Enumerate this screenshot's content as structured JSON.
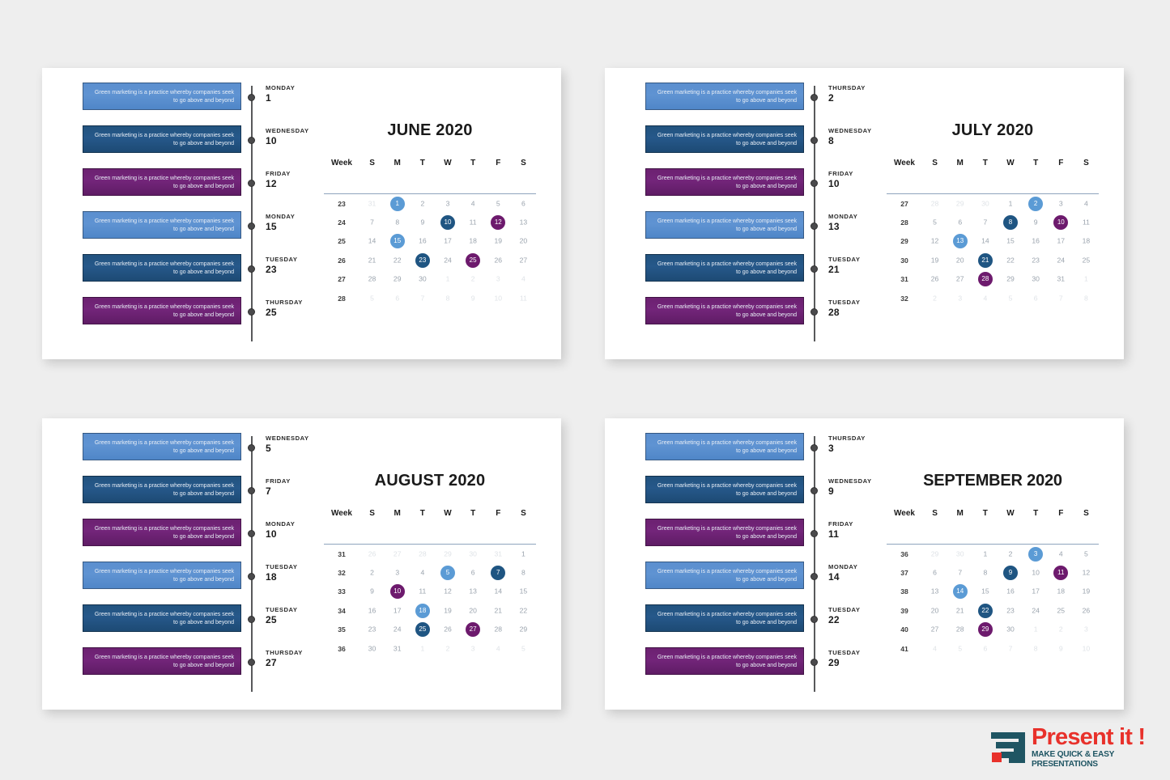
{
  "background_color": "#eeeeee",
  "colors": {
    "bar_light_blue": "#5b8fcf",
    "bar_dark_blue": "#22537f",
    "bar_purple": "#6c2171",
    "marker_light_blue": "#5b9bd5",
    "marker_dark_blue": "#1f5582",
    "marker_purple": "#6d1a6d",
    "timeline_axis": "#58595b",
    "header_rule": "#8fa4bd",
    "logo_red": "#e8312b",
    "logo_teal": "#1f5563"
  },
  "bar_text": "Green marketing is a practice whereby companies seek to go above and beyond",
  "week_header_label": "Week",
  "weekday_headers": [
    "S",
    "M",
    "T",
    "W",
    "T",
    "F",
    "S"
  ],
  "slides": [
    {
      "id": "june",
      "title": "JUNE 2020",
      "timeline": [
        {
          "day": "MONDAY",
          "date": "1",
          "color": "lightblue"
        },
        {
          "day": "WEDNESDAY",
          "date": "10",
          "color": "darkblue"
        },
        {
          "day": "FRIDAY",
          "date": "12",
          "color": "purple"
        },
        {
          "day": "MONDAY",
          "date": "15",
          "color": "lightblue"
        },
        {
          "day": "TUESDAY",
          "date": "23",
          "color": "darkblue"
        },
        {
          "day": "THURSDAY",
          "date": "25",
          "color": "purple"
        }
      ],
      "weeks": [
        "23",
        "24",
        "25",
        "26",
        "27",
        "28"
      ],
      "grid": [
        [
          {
            "n": "31",
            "state": "muted"
          },
          {
            "n": "1",
            "state": "marked",
            "color": "lightblue"
          },
          {
            "n": "2",
            "state": "normal"
          },
          {
            "n": "3",
            "state": "normal"
          },
          {
            "n": "4",
            "state": "normal"
          },
          {
            "n": "5",
            "state": "normal"
          },
          {
            "n": "6",
            "state": "normal"
          }
        ],
        [
          {
            "n": "7",
            "state": "normal"
          },
          {
            "n": "8",
            "state": "normal"
          },
          {
            "n": "9",
            "state": "normal"
          },
          {
            "n": "10",
            "state": "marked",
            "color": "darkblue"
          },
          {
            "n": "11",
            "state": "normal"
          },
          {
            "n": "12",
            "state": "marked",
            "color": "purple"
          },
          {
            "n": "13",
            "state": "normal"
          }
        ],
        [
          {
            "n": "14",
            "state": "normal"
          },
          {
            "n": "15",
            "state": "marked",
            "color": "lightblue"
          },
          {
            "n": "16",
            "state": "normal"
          },
          {
            "n": "17",
            "state": "normal"
          },
          {
            "n": "18",
            "state": "normal"
          },
          {
            "n": "19",
            "state": "normal"
          },
          {
            "n": "20",
            "state": "normal"
          }
        ],
        [
          {
            "n": "21",
            "state": "normal"
          },
          {
            "n": "22",
            "state": "normal"
          },
          {
            "n": "23",
            "state": "marked",
            "color": "darkblue"
          },
          {
            "n": "24",
            "state": "normal"
          },
          {
            "n": "25",
            "state": "marked",
            "color": "purple"
          },
          {
            "n": "26",
            "state": "normal"
          },
          {
            "n": "27",
            "state": "normal"
          }
        ],
        [
          {
            "n": "28",
            "state": "normal"
          },
          {
            "n": "29",
            "state": "normal"
          },
          {
            "n": "30",
            "state": "normal"
          },
          {
            "n": "1",
            "state": "muted"
          },
          {
            "n": "2",
            "state": "muted"
          },
          {
            "n": "3",
            "state": "muted"
          },
          {
            "n": "4",
            "state": "muted"
          }
        ],
        [
          {
            "n": "5",
            "state": "muted"
          },
          {
            "n": "6",
            "state": "muted"
          },
          {
            "n": "7",
            "state": "muted"
          },
          {
            "n": "8",
            "state": "muted"
          },
          {
            "n": "9",
            "state": "muted"
          },
          {
            "n": "10",
            "state": "muted"
          },
          {
            "n": "11",
            "state": "muted"
          }
        ]
      ]
    },
    {
      "id": "july",
      "title": "JULY 2020",
      "timeline": [
        {
          "day": "THURSDAY",
          "date": "2",
          "color": "lightblue"
        },
        {
          "day": "WEDNESDAY",
          "date": "8",
          "color": "darkblue"
        },
        {
          "day": "FRIDAY",
          "date": "10",
          "color": "purple"
        },
        {
          "day": "MONDAY",
          "date": "13",
          "color": "lightblue"
        },
        {
          "day": "TUESDAY",
          "date": "21",
          "color": "darkblue"
        },
        {
          "day": "TUESDAY",
          "date": "28",
          "color": "purple"
        }
      ],
      "weeks": [
        "27",
        "28",
        "29",
        "30",
        "31",
        "32"
      ],
      "grid": [
        [
          {
            "n": "28",
            "state": "muted"
          },
          {
            "n": "29",
            "state": "muted"
          },
          {
            "n": "30",
            "state": "muted"
          },
          {
            "n": "1",
            "state": "normal"
          },
          {
            "n": "2",
            "state": "marked",
            "color": "lightblue"
          },
          {
            "n": "3",
            "state": "normal"
          },
          {
            "n": "4",
            "state": "normal"
          }
        ],
        [
          {
            "n": "5",
            "state": "normal"
          },
          {
            "n": "6",
            "state": "normal"
          },
          {
            "n": "7",
            "state": "normal"
          },
          {
            "n": "8",
            "state": "marked",
            "color": "darkblue"
          },
          {
            "n": "9",
            "state": "normal"
          },
          {
            "n": "10",
            "state": "marked",
            "color": "purple"
          },
          {
            "n": "11",
            "state": "normal"
          }
        ],
        [
          {
            "n": "12",
            "state": "normal"
          },
          {
            "n": "13",
            "state": "marked",
            "color": "lightblue"
          },
          {
            "n": "14",
            "state": "normal"
          },
          {
            "n": "15",
            "state": "normal"
          },
          {
            "n": "16",
            "state": "normal"
          },
          {
            "n": "17",
            "state": "normal"
          },
          {
            "n": "18",
            "state": "normal"
          }
        ],
        [
          {
            "n": "19",
            "state": "normal"
          },
          {
            "n": "20",
            "state": "normal"
          },
          {
            "n": "21",
            "state": "marked",
            "color": "darkblue"
          },
          {
            "n": "22",
            "state": "normal"
          },
          {
            "n": "23",
            "state": "normal"
          },
          {
            "n": "24",
            "state": "normal"
          },
          {
            "n": "25",
            "state": "normal"
          }
        ],
        [
          {
            "n": "26",
            "state": "normal"
          },
          {
            "n": "27",
            "state": "normal"
          },
          {
            "n": "28",
            "state": "marked",
            "color": "purple"
          },
          {
            "n": "29",
            "state": "normal"
          },
          {
            "n": "30",
            "state": "normal"
          },
          {
            "n": "31",
            "state": "normal"
          },
          {
            "n": "1",
            "state": "muted"
          }
        ],
        [
          {
            "n": "2",
            "state": "muted"
          },
          {
            "n": "3",
            "state": "muted"
          },
          {
            "n": "4",
            "state": "muted"
          },
          {
            "n": "5",
            "state": "muted"
          },
          {
            "n": "6",
            "state": "muted"
          },
          {
            "n": "7",
            "state": "muted"
          },
          {
            "n": "8",
            "state": "muted"
          }
        ]
      ]
    },
    {
      "id": "august",
      "title": "AUGUST 2020",
      "timeline": [
        {
          "day": "WEDNESDAY",
          "date": "5",
          "color": "lightblue"
        },
        {
          "day": "FRIDAY",
          "date": "7",
          "color": "darkblue"
        },
        {
          "day": "MONDAY",
          "date": "10",
          "color": "purple"
        },
        {
          "day": "TUESDAY",
          "date": "18",
          "color": "lightblue"
        },
        {
          "day": "TUESDAY",
          "date": "25",
          "color": "darkblue"
        },
        {
          "day": "THURSDAY",
          "date": "27",
          "color": "purple"
        }
      ],
      "weeks": [
        "31",
        "32",
        "33",
        "34",
        "35",
        "36"
      ],
      "grid": [
        [
          {
            "n": "26",
            "state": "muted"
          },
          {
            "n": "27",
            "state": "muted"
          },
          {
            "n": "28",
            "state": "muted"
          },
          {
            "n": "29",
            "state": "muted"
          },
          {
            "n": "30",
            "state": "muted"
          },
          {
            "n": "31",
            "state": "muted"
          },
          {
            "n": "1",
            "state": "normal"
          }
        ],
        [
          {
            "n": "2",
            "state": "normal"
          },
          {
            "n": "3",
            "state": "normal"
          },
          {
            "n": "4",
            "state": "normal"
          },
          {
            "n": "5",
            "state": "marked",
            "color": "lightblue"
          },
          {
            "n": "6",
            "state": "normal"
          },
          {
            "n": "7",
            "state": "marked",
            "color": "darkblue"
          },
          {
            "n": "8",
            "state": "normal"
          }
        ],
        [
          {
            "n": "9",
            "state": "normal"
          },
          {
            "n": "10",
            "state": "marked",
            "color": "purple"
          },
          {
            "n": "11",
            "state": "normal"
          },
          {
            "n": "12",
            "state": "normal"
          },
          {
            "n": "13",
            "state": "normal"
          },
          {
            "n": "14",
            "state": "normal"
          },
          {
            "n": "15",
            "state": "normal"
          }
        ],
        [
          {
            "n": "16",
            "state": "normal"
          },
          {
            "n": "17",
            "state": "normal"
          },
          {
            "n": "18",
            "state": "marked",
            "color": "lightblue"
          },
          {
            "n": "19",
            "state": "normal"
          },
          {
            "n": "20",
            "state": "normal"
          },
          {
            "n": "21",
            "state": "normal"
          },
          {
            "n": "22",
            "state": "normal"
          }
        ],
        [
          {
            "n": "23",
            "state": "normal"
          },
          {
            "n": "24",
            "state": "normal"
          },
          {
            "n": "25",
            "state": "marked",
            "color": "darkblue"
          },
          {
            "n": "26",
            "state": "normal"
          },
          {
            "n": "27",
            "state": "marked",
            "color": "purple"
          },
          {
            "n": "28",
            "state": "normal"
          },
          {
            "n": "29",
            "state": "normal"
          }
        ],
        [
          {
            "n": "30",
            "state": "normal"
          },
          {
            "n": "31",
            "state": "normal"
          },
          {
            "n": "1",
            "state": "muted"
          },
          {
            "n": "2",
            "state": "muted"
          },
          {
            "n": "3",
            "state": "muted"
          },
          {
            "n": "4",
            "state": "muted"
          },
          {
            "n": "5",
            "state": "muted"
          }
        ]
      ]
    },
    {
      "id": "september",
      "title": "SEPTEMBER 2020",
      "timeline": [
        {
          "day": "THURSDAY",
          "date": "3",
          "color": "lightblue"
        },
        {
          "day": "WEDNESDAY",
          "date": "9",
          "color": "darkblue"
        },
        {
          "day": "FRIDAY",
          "date": "11",
          "color": "purple"
        },
        {
          "day": "MONDAY",
          "date": "14",
          "color": "lightblue"
        },
        {
          "day": "TUESDAY",
          "date": "22",
          "color": "darkblue"
        },
        {
          "day": "TUESDAY",
          "date": "29",
          "color": "purple"
        }
      ],
      "weeks": [
        "36",
        "37",
        "38",
        "39",
        "40",
        "41"
      ],
      "grid": [
        [
          {
            "n": "29",
            "state": "muted"
          },
          {
            "n": "30",
            "state": "muted"
          },
          {
            "n": "1",
            "state": "normal"
          },
          {
            "n": "2",
            "state": "normal"
          },
          {
            "n": "3",
            "state": "marked",
            "color": "lightblue"
          },
          {
            "n": "4",
            "state": "normal"
          },
          {
            "n": "5",
            "state": "normal"
          }
        ],
        [
          {
            "n": "6",
            "state": "normal"
          },
          {
            "n": "7",
            "state": "normal"
          },
          {
            "n": "8",
            "state": "normal"
          },
          {
            "n": "9",
            "state": "marked",
            "color": "darkblue"
          },
          {
            "n": "10",
            "state": "normal"
          },
          {
            "n": "11",
            "state": "marked",
            "color": "purple"
          },
          {
            "n": "12",
            "state": "normal"
          }
        ],
        [
          {
            "n": "13",
            "state": "normal"
          },
          {
            "n": "14",
            "state": "marked",
            "color": "lightblue"
          },
          {
            "n": "15",
            "state": "normal"
          },
          {
            "n": "16",
            "state": "normal"
          },
          {
            "n": "17",
            "state": "normal"
          },
          {
            "n": "18",
            "state": "normal"
          },
          {
            "n": "19",
            "state": "normal"
          }
        ],
        [
          {
            "n": "20",
            "state": "normal"
          },
          {
            "n": "21",
            "state": "normal"
          },
          {
            "n": "22",
            "state": "marked",
            "color": "darkblue"
          },
          {
            "n": "23",
            "state": "normal"
          },
          {
            "n": "24",
            "state": "normal"
          },
          {
            "n": "25",
            "state": "normal"
          },
          {
            "n": "26",
            "state": "normal"
          }
        ],
        [
          {
            "n": "27",
            "state": "normal"
          },
          {
            "n": "28",
            "state": "normal"
          },
          {
            "n": "29",
            "state": "marked",
            "color": "purple"
          },
          {
            "n": "30",
            "state": "normal"
          },
          {
            "n": "1",
            "state": "muted"
          },
          {
            "n": "2",
            "state": "muted"
          },
          {
            "n": "3",
            "state": "muted"
          }
        ],
        [
          {
            "n": "4",
            "state": "muted"
          },
          {
            "n": "5",
            "state": "muted"
          },
          {
            "n": "6",
            "state": "muted"
          },
          {
            "n": "7",
            "state": "muted"
          },
          {
            "n": "8",
            "state": "muted"
          },
          {
            "n": "9",
            "state": "muted"
          },
          {
            "n": "10",
            "state": "muted"
          }
        ]
      ]
    }
  ],
  "logo": {
    "title": "Present it !",
    "subtitle": "MAKE QUICK & EASY PRESENTATIONS"
  }
}
